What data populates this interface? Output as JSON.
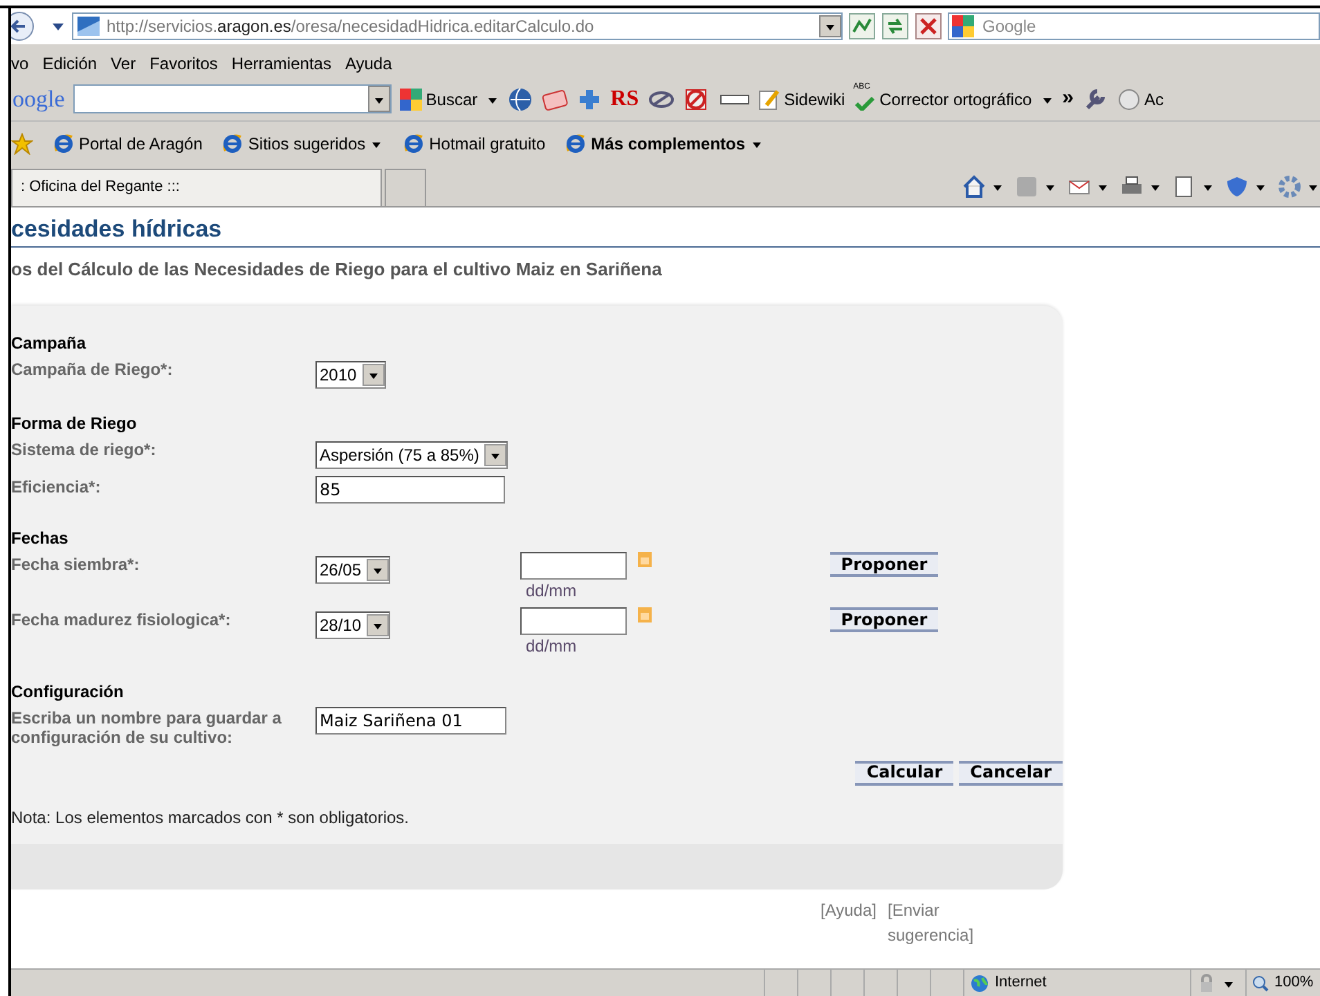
{
  "address_bar": {
    "url": [
      {
        "text": "http://servicios.",
        "emphasis": false
      },
      {
        "text": "aragon.es",
        "emphasis": true
      },
      {
        "text": "/oresa/necesidadHidrica.editarCalculo.do",
        "emphasis": false
      }
    ],
    "search_placeholder": "Google"
  },
  "menu": [
    "vo",
    "Edición",
    "Ver",
    "Favoritos",
    "Herramientas",
    "Ayuda"
  ],
  "google_toolbar": {
    "logo": "oogle",
    "search_button": "Buscar",
    "rs_label": "RS",
    "sidewiki": "Sidewiki",
    "spell_icon_text": "ABC",
    "spellcheck": "Corrector ortográfico",
    "more": "»",
    "cut_label": "Ac"
  },
  "favorites": [
    {
      "label": "Portal de Aragón",
      "dropdown": false,
      "bold": false
    },
    {
      "label": "Sitios sugeridos",
      "dropdown": true,
      "bold": false
    },
    {
      "label": "Hotmail gratuito",
      "dropdown": false,
      "bold": false
    },
    {
      "label": "Más complementos",
      "dropdown": true,
      "bold": true
    }
  ],
  "tabs": [
    {
      "label": ": Oficina del Regante :::",
      "selected": true
    }
  ],
  "page": {
    "title": "cesidades hídricas",
    "subtitle": "os del Cálculo de las Necesidades de Riego para el cultivo Maiz en Sariñena"
  },
  "sections": [
    {
      "heading": "Campaña",
      "rows": [
        {
          "label": "Campaña de Riego*:",
          "kind": "select",
          "value": "2010"
        }
      ]
    },
    {
      "heading": "Forma de Riego",
      "rows": [
        {
          "label": "Sistema de riego*:",
          "kind": "select",
          "value": "Aspersión (75 a 85%)"
        },
        {
          "label": "Eficiencia*:",
          "kind": "text",
          "value": "85"
        }
      ]
    },
    {
      "heading": "Fechas",
      "rows": [
        {
          "label": "Fecha siembra*:",
          "kind": "date",
          "value": "26/05",
          "hint": "dd/mm",
          "button": "Proponer"
        },
        {
          "label": "Fecha madurez fisiologica*:",
          "kind": "date",
          "value": "28/10",
          "hint": "dd/mm",
          "button": "Proponer"
        }
      ]
    },
    {
      "heading": "Configuración",
      "rows": [
        {
          "label": "Escriba un nombre para guardar a configuración de su cultivo:",
          "kind": "text",
          "value": "Maiz Sariñena 01"
        }
      ]
    }
  ],
  "actions": [
    "Calcular",
    "Cancelar"
  ],
  "note": "Nota: Los elementos marcados con * son obligatorios.",
  "footer_links": [
    "[Ayuda]",
    "[Enviar sugerencia]"
  ],
  "status_bar": {
    "zone": "Internet",
    "zoom": "100%"
  }
}
